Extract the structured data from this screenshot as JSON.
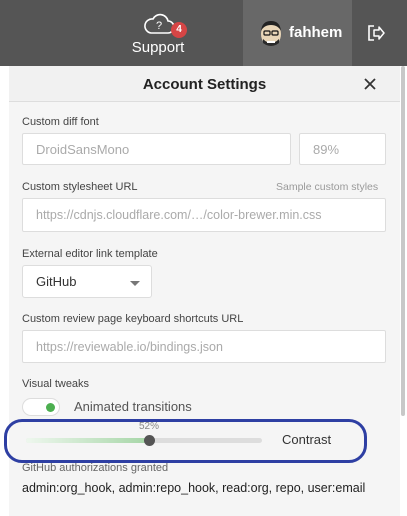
{
  "topbar": {
    "support": {
      "label": "Support",
      "badge": "4",
      "icon": "cloud-question-icon"
    },
    "user": {
      "name": "fahhem",
      "avatar": "avatar-icon"
    },
    "logout_icon": "sign-out-icon",
    "colors": {
      "bar": "#555555",
      "user_bg": "#686868",
      "badge": "#d64545"
    }
  },
  "panel": {
    "title": "Account Settings",
    "close_icon": "close-icon",
    "fields": {
      "diff_font": {
        "label": "Custom diff font",
        "font_placeholder": "DroidSansMono",
        "size_placeholder": "89%"
      },
      "stylesheet": {
        "label": "Custom stylesheet URL",
        "link": "Sample custom styles",
        "placeholder": "https://cdnjs.cloudflare.com/…/color-brewer.min.css"
      },
      "editor": {
        "label": "External editor link template",
        "value": "GitHub"
      },
      "shortcuts": {
        "label": "Custom review page keyboard shortcuts URL",
        "placeholder": "https://reviewable.io/bindings.json"
      },
      "visual": {
        "label": "Visual tweaks",
        "animated": {
          "label": "Animated transitions",
          "on": true
        },
        "contrast": {
          "label": "Contrast",
          "value_text": "52%",
          "value": 0.52
        }
      },
      "auth": {
        "label": "GitHub authorizations granted",
        "value": "admin:org_hook, admin:repo_hook, read:org, repo, user:email"
      }
    }
  },
  "accent": {
    "highlight": "#2e3fa3",
    "toggle_on": "#4caf50"
  }
}
